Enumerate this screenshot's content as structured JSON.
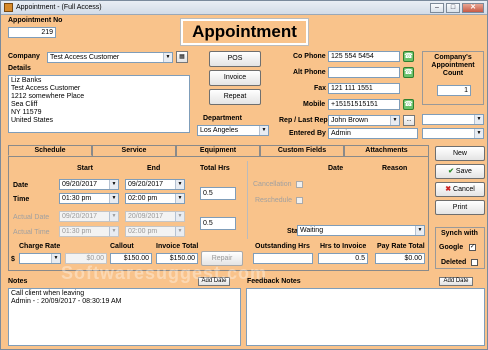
{
  "window": {
    "title": "Appointment - (Full Access)"
  },
  "header": {
    "appointment_no_label": "Appointment No",
    "appointment_no": "219",
    "title": "Appointment"
  },
  "company": {
    "label": "Company",
    "value": "Test Access Customer",
    "details_label": "Details",
    "details": [
      "Liz Banks",
      "Test Access Customer",
      "1212 somewhere Place",
      "Sea Cliff",
      "NY 11579",
      "United States"
    ]
  },
  "center_buttons": {
    "pos": "POS",
    "invoice": "Invoice",
    "repeat": "Repeat"
  },
  "department": {
    "label": "Department",
    "value": "Los Angeles"
  },
  "contact": {
    "co_phone_label": "Co Phone",
    "co_phone": "125 554 5454",
    "alt_phone_label": "Alt Phone",
    "alt_phone": "",
    "fax_label": "Fax",
    "fax": "121 111 1551",
    "mobile_label": "Mobile",
    "mobile": "+15151515151",
    "rep_label": "Rep / Last Rep",
    "rep": "John Brown",
    "rep_more": "...",
    "entered_by_label": "Entered By",
    "entered_by": "Admin"
  },
  "appt_count": {
    "label": "Company's Appointment Count",
    "value": "1"
  },
  "tabs": [
    {
      "label": "Schedule"
    },
    {
      "label": "Service"
    },
    {
      "label": "Equipment"
    },
    {
      "label": "Custom Fields"
    },
    {
      "label": "Attachments"
    }
  ],
  "schedule": {
    "start_header": "Start",
    "end_header": "End",
    "total_hrs_header": "Total  Hrs",
    "date_label": "Date",
    "time_label": "Time",
    "actual_date_label": "Actual Date",
    "actual_time_label": "Actual Time",
    "start_date": "09/20/2017",
    "start_time": "01:30 pm",
    "end_date": "09/20/2017",
    "end_time": "02:00 pm",
    "total_hrs": "0.5",
    "actual_start_date": "09/20/2017",
    "actual_start_time": "01:30 pm",
    "actual_end_date": "20/09/2017",
    "actual_end_time": "02:00 pm",
    "actual_total_hrs": "0.5",
    "date_col": "Date",
    "reason_col": "Reason",
    "cancellation_label": "Cancellation",
    "reschedule_label": "Reschedule",
    "status_label": "Status",
    "status_value": "Waiting"
  },
  "charges": {
    "charge_rate_label": "Charge Rate",
    "currency": "$",
    "charge_rate": "$0.00",
    "callout_label": "Callout",
    "callout": "$150.00",
    "invoice_total_label": "Invoice Total",
    "invoice_total": "$150.00",
    "repair_label": "Repair",
    "outstanding_label": "Outstanding Hrs",
    "outstanding": "",
    "hrs_to_invoice_label": "Hrs to Invoice",
    "hrs_to_invoice": "0.5",
    "pay_rate_total_label": "Pay Rate Total",
    "pay_rate_total": "$0.00"
  },
  "side_buttons": {
    "new": "New",
    "save": "Save",
    "cancel": "Cancel",
    "print": "Print"
  },
  "synch": {
    "title": "Synch with",
    "google_label": "Google",
    "google_checked": "✓",
    "deleted_label": "Deleted"
  },
  "notes": {
    "label": "Notes",
    "add_date": "Add Date",
    "lines": [
      "Call client when leaving",
      "Admin   -  : 20/09/2017 - 08:30:19 AM"
    ]
  },
  "feedback": {
    "label": "Feedback Notes",
    "add_date": "Add Date"
  },
  "watermark": "Softwaresuggest.com"
}
